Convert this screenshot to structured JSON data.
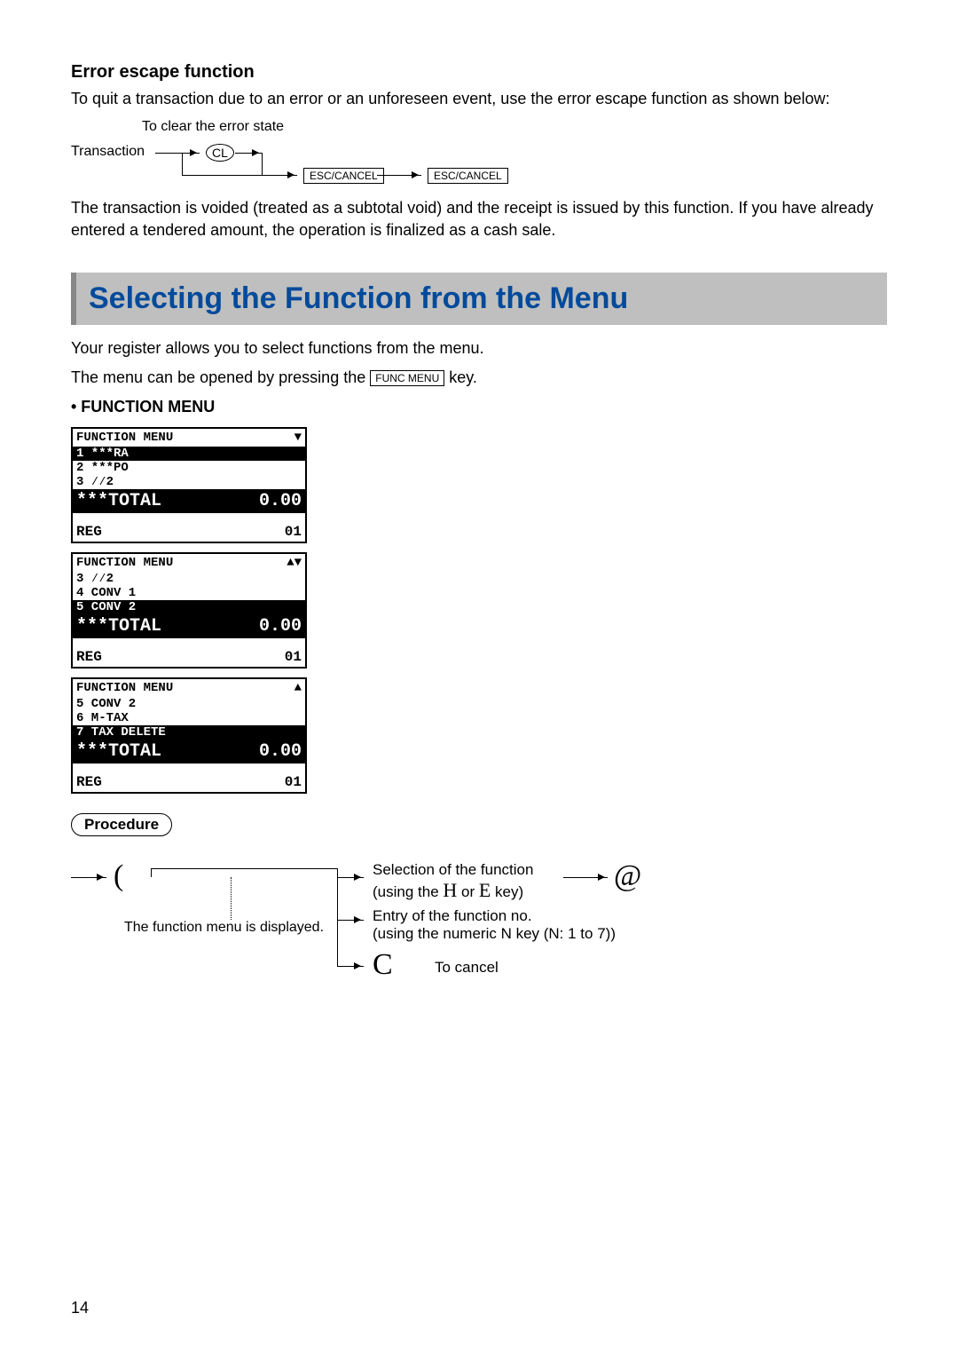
{
  "section1": {
    "title": "Error escape function",
    "intro": "To quit a transaction due to an error or an unforeseen event, use the error escape function as shown below:",
    "diagram": {
      "caption": "To clear the error state",
      "transaction": "Transaction",
      "cl": "CL",
      "esc1": "ESC/CANCEL",
      "esc2": "ESC/CANCEL"
    },
    "para": "The transaction is voided (treated as a subtotal void) and the receipt is issued by this function. If you have already entered a tendered amount, the operation is finalized as a cash sale."
  },
  "banner": {
    "title": "Selecting the Function from the Menu"
  },
  "section2": {
    "line1": "Your register allows you to select functions from the menu.",
    "line2a": "The menu can be opened by pressing the ",
    "funcmenu_key": "FUNC MENU",
    "line2b": " key.",
    "bullet": "• FUNCTION MENU"
  },
  "lcd1": {
    "header": "FUNCTION MENU",
    "scroll": "▼",
    "rows": [
      "1 ***RA",
      "2 ***PO",
      "3 ⁄⁄2"
    ],
    "total_label": "***TOTAL",
    "total_val": "0.00",
    "mode": "REG",
    "mode_val": "01"
  },
  "lcd2": {
    "header": "FUNCTION MENU",
    "scroll": "▲▼",
    "rows": [
      "3 ⁄⁄2",
      "4 CONV 1",
      "5 CONV 2"
    ],
    "total_label": "***TOTAL",
    "total_val": "0.00",
    "mode": "REG",
    "mode_val": "01"
  },
  "lcd3": {
    "header": "FUNCTION MENU",
    "scroll": "▲",
    "rows": [
      "5 CONV 2",
      "6 M-TAX",
      "7 TAX DELETE"
    ],
    "total_label": "***TOTAL",
    "total_val": "0.00",
    "mode": "REG",
    "mode_val": "01"
  },
  "procedure": {
    "label": "Procedure",
    "open": "(",
    "at": "@",
    "c": "C",
    "menu_displayed": "The function menu is displayed.",
    "sel1": "Selection of the function",
    "sel2a": "(using the ",
    "h": "H",
    "sel2b": " or ",
    "e": "E",
    "sel2c": "  key)",
    "entry1": "Entry of the function no.",
    "entry2": "(using the numeric N key (N: 1 to 7))",
    "cancel": "To cancel"
  },
  "page": "14"
}
